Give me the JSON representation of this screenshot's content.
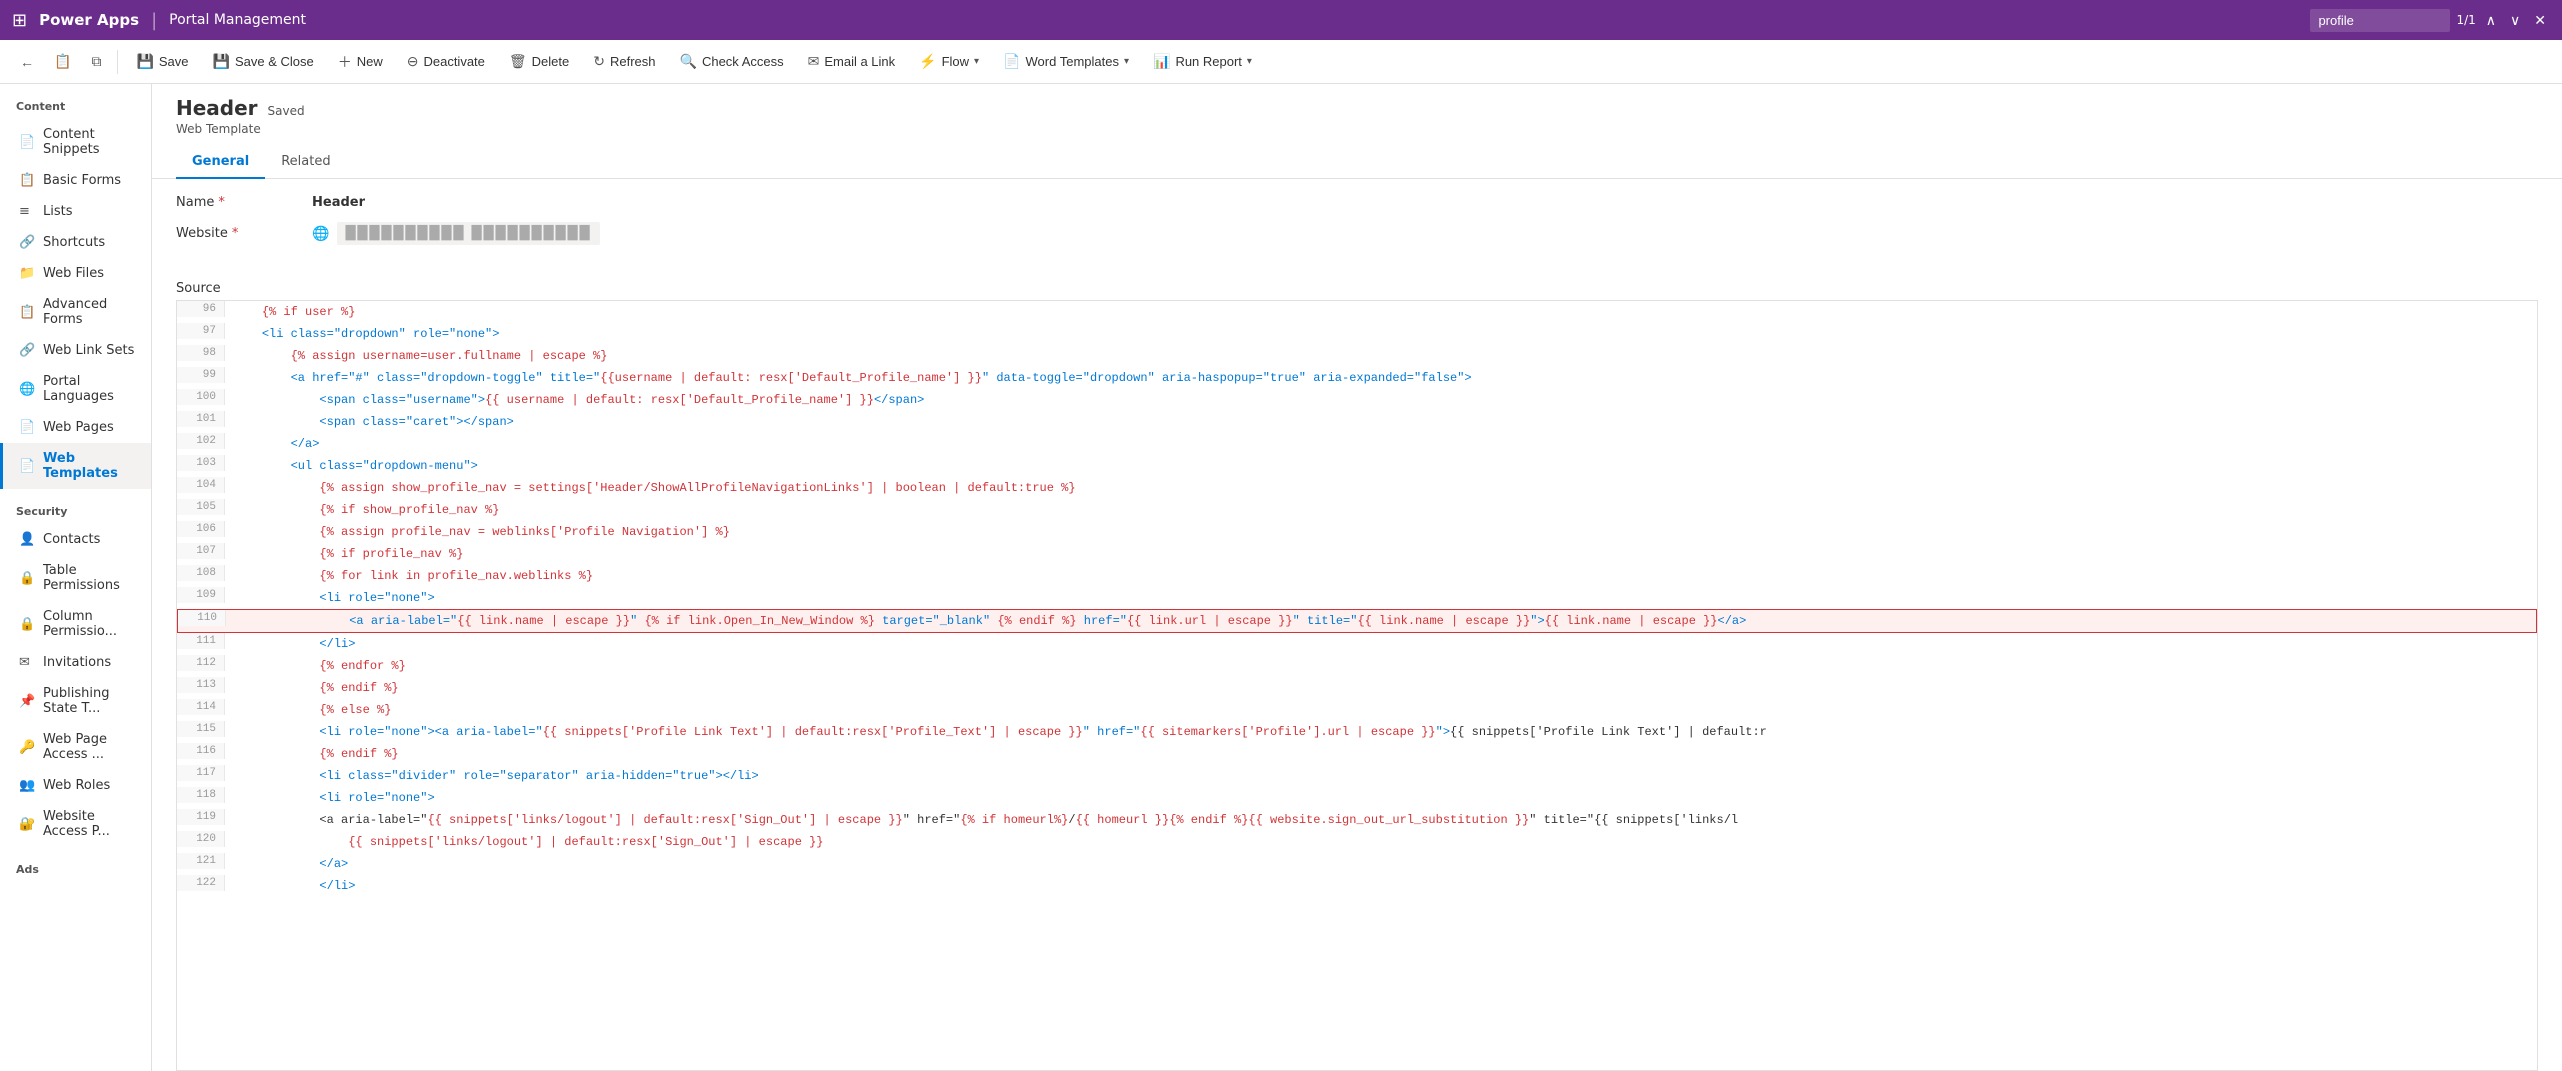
{
  "topbar": {
    "app_name": "Power Apps",
    "divider": "|",
    "record_name": "Portal Management",
    "search_placeholder": "profile",
    "search_count": "1/1"
  },
  "commandbar": {
    "back_label": "←",
    "notes_label": "📋",
    "new_window_label": "⧉",
    "save_label": "Save",
    "save_close_label": "Save & Close",
    "new_label": "New",
    "deactivate_label": "Deactivate",
    "delete_label": "Delete",
    "refresh_label": "Refresh",
    "check_access_label": "Check Access",
    "email_link_label": "Email a Link",
    "flow_label": "Flow",
    "word_templates_label": "Word Templates",
    "run_report_label": "Run Report"
  },
  "record": {
    "title": "Header",
    "saved_badge": "Saved",
    "subtitle": "Web Template"
  },
  "tabs": [
    {
      "label": "General",
      "active": true
    },
    {
      "label": "Related",
      "active": false
    }
  ],
  "form": {
    "name_label": "Name",
    "name_value": "Header",
    "website_label": "Website",
    "website_placeholder": "██████████ ██████████"
  },
  "source_label": "Source",
  "sidebar": {
    "content_section": "Content",
    "items_content": [
      {
        "label": "Content Snippets",
        "icon": "📄",
        "active": false
      },
      {
        "label": "Basic Forms",
        "icon": "📋",
        "active": false
      },
      {
        "label": "Lists",
        "icon": "≡",
        "active": false
      },
      {
        "label": "Shortcuts",
        "icon": "🔗",
        "active": false
      },
      {
        "label": "Web Files",
        "icon": "📁",
        "active": false
      },
      {
        "label": "Advanced Forms",
        "icon": "📋",
        "active": false
      },
      {
        "label": "Web Link Sets",
        "icon": "🔗",
        "active": false
      },
      {
        "label": "Portal Languages",
        "icon": "🌐",
        "active": false
      },
      {
        "label": "Web Pages",
        "icon": "📄",
        "active": false
      },
      {
        "label": "Web Templates",
        "icon": "📄",
        "active": true
      }
    ],
    "security_section": "Security",
    "items_security": [
      {
        "label": "Contacts",
        "icon": "👤",
        "active": false
      },
      {
        "label": "Table Permissions",
        "icon": "🔒",
        "active": false
      },
      {
        "label": "Column Permissio...",
        "icon": "🔒",
        "active": false
      },
      {
        "label": "Invitations",
        "icon": "✉",
        "active": false
      },
      {
        "label": "Publishing State T...",
        "icon": "📌",
        "active": false
      },
      {
        "label": "Web Page Access ...",
        "icon": "🔑",
        "active": false
      },
      {
        "label": "Web Roles",
        "icon": "👥",
        "active": false
      },
      {
        "label": "Website Access P...",
        "icon": "🔐",
        "active": false
      }
    ],
    "ads_section": "Ads"
  },
  "code_lines": [
    {
      "num": "96",
      "content": "    {% if user %}",
      "highlighted": false
    },
    {
      "num": "97",
      "content": "    <li class=\"dropdown\" role=\"none\">",
      "highlighted": false
    },
    {
      "num": "98",
      "content": "        {% assign username=user.fullname | escape %}",
      "highlighted": false
    },
    {
      "num": "99",
      "content": "        <a href=\"#\" class=\"dropdown-toggle\" title=\"{{username | default: resx['Default_Profile_name'] }}\" data-toggle=\"dropdown\" aria-haspopup=\"true\" aria-expanded=\"false\">",
      "highlighted": false
    },
    {
      "num": "100",
      "content": "            <span class=\"username\">{{ username | default: resx['Default_Profile_name'] }}</span>",
      "highlighted": false
    },
    {
      "num": "101",
      "content": "            <span class=\"caret\"></span>",
      "highlighted": false
    },
    {
      "num": "102",
      "content": "        </a>",
      "highlighted": false
    },
    {
      "num": "103",
      "content": "        <ul class=\"dropdown-menu\">",
      "highlighted": false
    },
    {
      "num": "104",
      "content": "            {% assign show_profile_nav = settings['Header/ShowAllProfileNavigationLinks'] | boolean | default:true %}",
      "highlighted": false
    },
    {
      "num": "105",
      "content": "            {% if show_profile_nav %}",
      "highlighted": false
    },
    {
      "num": "106",
      "content": "            {% assign profile_nav = weblinks['Profile Navigation'] %}",
      "highlighted": false
    },
    {
      "num": "107",
      "content": "            {% if profile_nav %}",
      "highlighted": false
    },
    {
      "num": "108",
      "content": "            {% for link in profile_nav.weblinks %}",
      "highlighted": false
    },
    {
      "num": "109",
      "content": "            <li role=\"none\">",
      "highlighted": false
    },
    {
      "num": "110",
      "content": "                <a aria-label=\"{{ link.name | escape }}\" {% if link.Open_In_New_Window %} target=\"_blank\" {% endif %} href=\"{{ link.url | escape }}\" title=\"{{ link.name | escape }}\">{{ link.name | escape }}</a>",
      "highlighted": true
    },
    {
      "num": "111",
      "content": "            </li>",
      "highlighted": false
    },
    {
      "num": "112",
      "content": "            {% endfor %}",
      "highlighted": false
    },
    {
      "num": "113",
      "content": "            {% endif %}",
      "highlighted": false
    },
    {
      "num": "114",
      "content": "            {% else %}",
      "highlighted": false
    },
    {
      "num": "115",
      "content": "            <li role=\"none\"><a aria-label=\"{{ snippets['Profile Link Text'] | default:resx['Profile_Text'] | escape }}\" href=\"{{ sitemarkers['Profile'].url | escape }}\">{{ snippets['Profile Link Text'] | default:r",
      "highlighted": false
    },
    {
      "num": "116",
      "content": "            {% endif %}",
      "highlighted": false
    },
    {
      "num": "117",
      "content": "            <li class=\"divider\" role=\"separator\" aria-hidden=\"true\"></li>",
      "highlighted": false
    },
    {
      "num": "118",
      "content": "            <li role=\"none\">",
      "highlighted": false
    },
    {
      "num": "119",
      "content": "            <a aria-label=\"{{ snippets['links/logout'] | default:resx['Sign_Out'] | escape }}\" href=\"{% if homeurl%}/{{ homeurl }}{% endif %}{{ website.sign_out_url_substitution }}\" title=\"{{ snippets['links/l",
      "highlighted": false
    },
    {
      "num": "120",
      "content": "                {{ snippets['links/logout'] | default:resx['Sign_Out'] | escape }}",
      "highlighted": false
    },
    {
      "num": "121",
      "content": "            </a>",
      "highlighted": false
    },
    {
      "num": "122",
      "content": "            </li>",
      "highlighted": false
    }
  ]
}
